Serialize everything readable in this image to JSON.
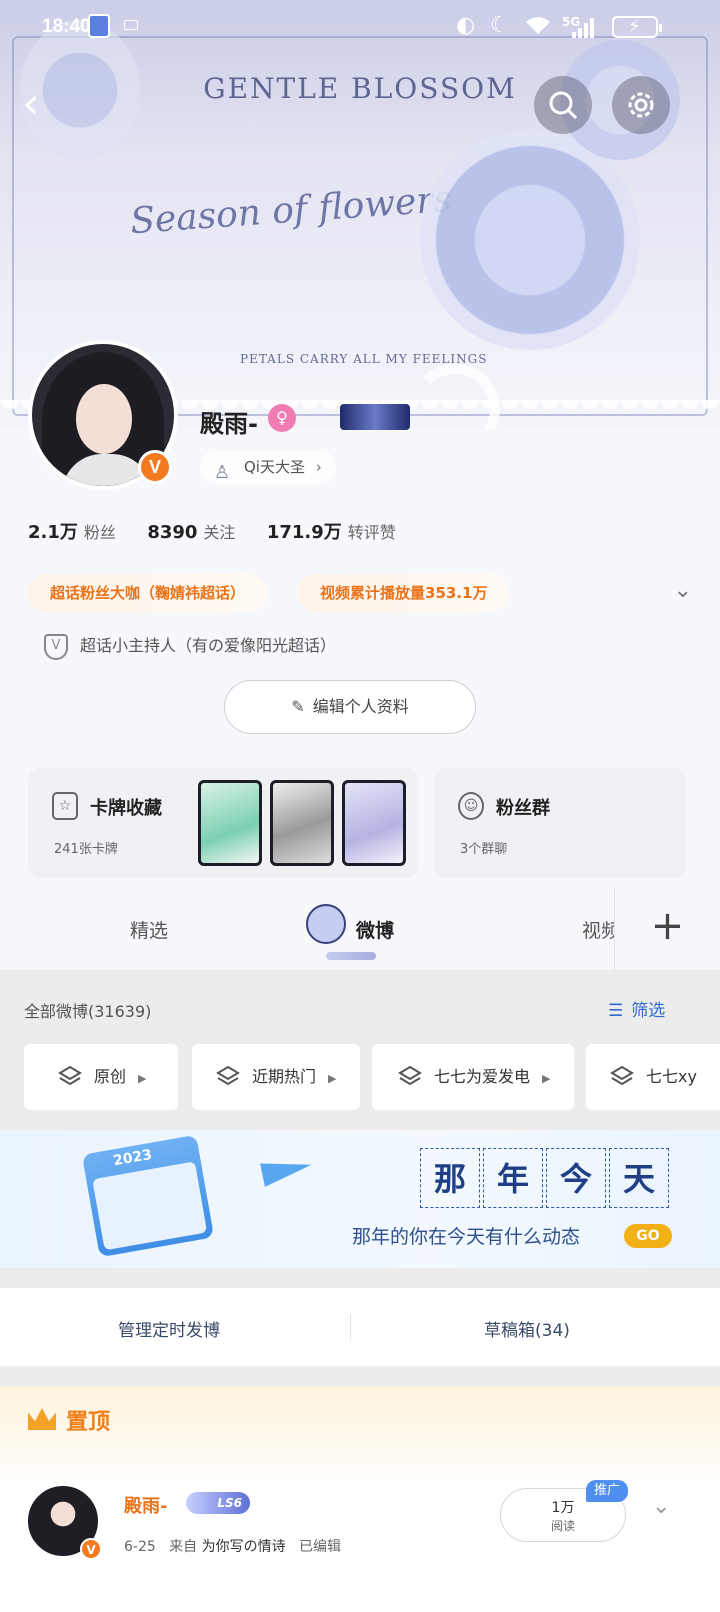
{
  "status_bar": {
    "time": "18:40",
    "network": "5G"
  },
  "banner": {
    "title": "GENTLE BLOSSOM",
    "script": "Season of flowers",
    "subtitle": "PETALS CARRY ALL MY FEELINGS"
  },
  "profile": {
    "username": "殿雨-",
    "title_chip": "Qi天大圣",
    "verified_badge": "V",
    "stats": [
      {
        "value": "2.1万",
        "label": "粉丝"
      },
      {
        "value": "8390",
        "label": "关注"
      },
      {
        "value": "171.9万",
        "label": "转评赞"
      }
    ],
    "honors": [
      "超话粉丝大咖（鞠婧祎超话）",
      "视频累计播放量353.1万"
    ],
    "host_line": "超话小主持人（有の爱像阳光超话）",
    "edit_button": "编辑个人资料"
  },
  "cards": {
    "card_collection": {
      "title": "卡牌收藏",
      "sub": "241张卡牌"
    },
    "fan_group": {
      "title": "粉丝群",
      "sub": "3个群聊"
    }
  },
  "tabs": [
    {
      "label": "精选"
    },
    {
      "label": "微博"
    },
    {
      "label": "视频"
    }
  ],
  "feed": {
    "all_count": "全部微博(31639)",
    "filter": "筛选",
    "chips": [
      "原创",
      "近期热门",
      "七七为爱发电",
      "七七xy"
    ]
  },
  "promo": {
    "title_chars": [
      "那",
      "年",
      "今",
      "天"
    ],
    "subtitle": "那年的你在今天有什么动态",
    "go": "GO",
    "calendar_year": "2023"
  },
  "manage": {
    "scheduled": "管理定时发博",
    "drafts": "草稿箱(34)"
  },
  "pinned": {
    "label": "置顶",
    "author": "殿雨-",
    "level": "LS6",
    "date": "6-25",
    "from": "来自",
    "source": "为你写の情诗",
    "edited": "已编辑",
    "read_count": "1万",
    "read_label": "阅读",
    "promo_tag": "推广"
  },
  "colors": {
    "accent_orange": "#f47a1f",
    "link_blue": "#2f6bd3"
  }
}
